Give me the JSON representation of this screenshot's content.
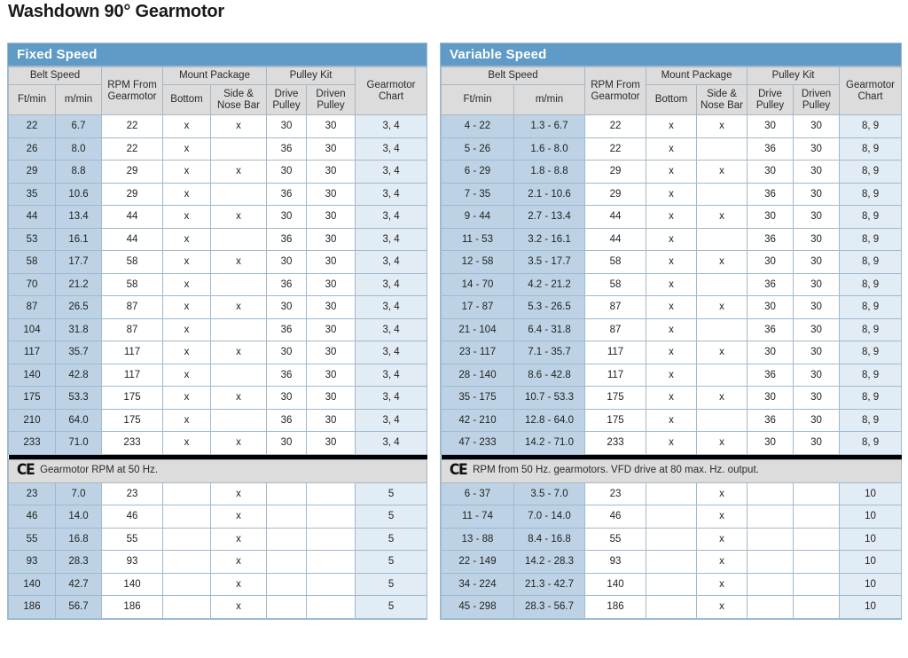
{
  "page": {
    "title": "Washdown 90° Gearmotor"
  },
  "colors": {
    "banner_blue": "#5f9bc6",
    "belt_fill": "#bdd3e5",
    "chart_fill": "#e2ecf5",
    "header_gray": "#dcdcdc",
    "grid_line": "#9fb9cf",
    "divider_black": "#000000"
  },
  "icons": {
    "ce_mark": "CE"
  },
  "headers": {
    "belt_speed": "Belt Speed",
    "ft_min": "Ft/min",
    "m_min": "m/min",
    "rpm_from_gearmotor": "RPM From Gearmotor",
    "mount_package": "Mount Package",
    "bottom": "Bottom",
    "side_nose_bar": "Side & Nose Bar",
    "pulley_kit": "Pulley Kit",
    "drive_pulley": "Drive Pulley",
    "driven_pulley": "Driven Pulley",
    "gearmotor_chart": "Gearmotor Chart"
  },
  "fixed_speed": {
    "banner": "Fixed Speed",
    "note": "Gearmotor RPM at 50 Hz.",
    "rows_main": [
      {
        "ft": "22",
        "m": "6.7",
        "rpm": "22",
        "bottom": "x",
        "side": "x",
        "drive": "30",
        "driven": "30",
        "chart": "3, 4"
      },
      {
        "ft": "26",
        "m": "8.0",
        "rpm": "22",
        "bottom": "x",
        "side": "",
        "drive": "36",
        "driven": "30",
        "chart": "3, 4"
      },
      {
        "ft": "29",
        "m": "8.8",
        "rpm": "29",
        "bottom": "x",
        "side": "x",
        "drive": "30",
        "driven": "30",
        "chart": "3, 4"
      },
      {
        "ft": "35",
        "m": "10.6",
        "rpm": "29",
        "bottom": "x",
        "side": "",
        "drive": "36",
        "driven": "30",
        "chart": "3, 4"
      },
      {
        "ft": "44",
        "m": "13.4",
        "rpm": "44",
        "bottom": "x",
        "side": "x",
        "drive": "30",
        "driven": "30",
        "chart": "3, 4"
      },
      {
        "ft": "53",
        "m": "16.1",
        "rpm": "44",
        "bottom": "x",
        "side": "",
        "drive": "36",
        "driven": "30",
        "chart": "3, 4"
      },
      {
        "ft": "58",
        "m": "17.7",
        "rpm": "58",
        "bottom": "x",
        "side": "x",
        "drive": "30",
        "driven": "30",
        "chart": "3, 4"
      },
      {
        "ft": "70",
        "m": "21.2",
        "rpm": "58",
        "bottom": "x",
        "side": "",
        "drive": "36",
        "driven": "30",
        "chart": "3, 4"
      },
      {
        "ft": "87",
        "m": "26.5",
        "rpm": "87",
        "bottom": "x",
        "side": "x",
        "drive": "30",
        "driven": "30",
        "chart": "3, 4"
      },
      {
        "ft": "104",
        "m": "31.8",
        "rpm": "87",
        "bottom": "x",
        "side": "",
        "drive": "36",
        "driven": "30",
        "chart": "3, 4"
      },
      {
        "ft": "117",
        "m": "35.7",
        "rpm": "117",
        "bottom": "x",
        "side": "x",
        "drive": "30",
        "driven": "30",
        "chart": "3, 4"
      },
      {
        "ft": "140",
        "m": "42.8",
        "rpm": "117",
        "bottom": "x",
        "side": "",
        "drive": "36",
        "driven": "30",
        "chart": "3, 4"
      },
      {
        "ft": "175",
        "m": "53.3",
        "rpm": "175",
        "bottom": "x",
        "side": "x",
        "drive": "30",
        "driven": "30",
        "chart": "3, 4"
      },
      {
        "ft": "210",
        "m": "64.0",
        "rpm": "175",
        "bottom": "x",
        "side": "",
        "drive": "36",
        "driven": "30",
        "chart": "3, 4"
      },
      {
        "ft": "233",
        "m": "71.0",
        "rpm": "233",
        "bottom": "x",
        "side": "x",
        "drive": "30",
        "driven": "30",
        "chart": "3, 4"
      }
    ],
    "rows_ce": [
      {
        "ft": "23",
        "m": "7.0",
        "rpm": "23",
        "bottom": "",
        "side": "x",
        "drive": "",
        "driven": "",
        "chart": "5"
      },
      {
        "ft": "46",
        "m": "14.0",
        "rpm": "46",
        "bottom": "",
        "side": "x",
        "drive": "",
        "driven": "",
        "chart": "5"
      },
      {
        "ft": "55",
        "m": "16.8",
        "rpm": "55",
        "bottom": "",
        "side": "x",
        "drive": "",
        "driven": "",
        "chart": "5"
      },
      {
        "ft": "93",
        "m": "28.3",
        "rpm": "93",
        "bottom": "",
        "side": "x",
        "drive": "",
        "driven": "",
        "chart": "5"
      },
      {
        "ft": "140",
        "m": "42.7",
        "rpm": "140",
        "bottom": "",
        "side": "x",
        "drive": "",
        "driven": "",
        "chart": "5"
      },
      {
        "ft": "186",
        "m": "56.7",
        "rpm": "186",
        "bottom": "",
        "side": "x",
        "drive": "",
        "driven": "",
        "chart": "5"
      }
    ]
  },
  "variable_speed": {
    "banner": "Variable Speed",
    "note": "RPM from 50 Hz. gearmotors. VFD drive at 80 max. Hz. output.",
    "rows_main": [
      {
        "ft": "4 - 22",
        "m": "1.3 - 6.7",
        "rpm": "22",
        "bottom": "x",
        "side": "x",
        "drive": "30",
        "driven": "30",
        "chart": "8, 9"
      },
      {
        "ft": "5 - 26",
        "m": "1.6 - 8.0",
        "rpm": "22",
        "bottom": "x",
        "side": "",
        "drive": "36",
        "driven": "30",
        "chart": "8, 9"
      },
      {
        "ft": "6 - 29",
        "m": "1.8 - 8.8",
        "rpm": "29",
        "bottom": "x",
        "side": "x",
        "drive": "30",
        "driven": "30",
        "chart": "8, 9"
      },
      {
        "ft": "7 - 35",
        "m": "2.1 - 10.6",
        "rpm": "29",
        "bottom": "x",
        "side": "",
        "drive": "36",
        "driven": "30",
        "chart": "8, 9"
      },
      {
        "ft": "9 - 44",
        "m": "2.7 - 13.4",
        "rpm": "44",
        "bottom": "x",
        "side": "x",
        "drive": "30",
        "driven": "30",
        "chart": "8, 9"
      },
      {
        "ft": "11 - 53",
        "m": "3.2 - 16.1",
        "rpm": "44",
        "bottom": "x",
        "side": "",
        "drive": "36",
        "driven": "30",
        "chart": "8, 9"
      },
      {
        "ft": "12 - 58",
        "m": "3.5 - 17.7",
        "rpm": "58",
        "bottom": "x",
        "side": "x",
        "drive": "30",
        "driven": "30",
        "chart": "8, 9"
      },
      {
        "ft": "14 - 70",
        "m": "4.2 - 21.2",
        "rpm": "58",
        "bottom": "x",
        "side": "",
        "drive": "36",
        "driven": "30",
        "chart": "8, 9"
      },
      {
        "ft": "17 - 87",
        "m": "5.3 - 26.5",
        "rpm": "87",
        "bottom": "x",
        "side": "x",
        "drive": "30",
        "driven": "30",
        "chart": "8, 9"
      },
      {
        "ft": "21 - 104",
        "m": "6.4 - 31.8",
        "rpm": "87",
        "bottom": "x",
        "side": "",
        "drive": "36",
        "driven": "30",
        "chart": "8, 9"
      },
      {
        "ft": "23 - 117",
        "m": "7.1 - 35.7",
        "rpm": "117",
        "bottom": "x",
        "side": "x",
        "drive": "30",
        "driven": "30",
        "chart": "8, 9"
      },
      {
        "ft": "28 - 140",
        "m": "8.6 - 42.8",
        "rpm": "117",
        "bottom": "x",
        "side": "",
        "drive": "36",
        "driven": "30",
        "chart": "8, 9"
      },
      {
        "ft": "35 - 175",
        "m": "10.7 - 53.3",
        "rpm": "175",
        "bottom": "x",
        "side": "x",
        "drive": "30",
        "driven": "30",
        "chart": "8, 9"
      },
      {
        "ft": "42 - 210",
        "m": "12.8 - 64.0",
        "rpm": "175",
        "bottom": "x",
        "side": "",
        "drive": "36",
        "driven": "30",
        "chart": "8, 9"
      },
      {
        "ft": "47 - 233",
        "m": "14.2 - 71.0",
        "rpm": "233",
        "bottom": "x",
        "side": "x",
        "drive": "30",
        "driven": "30",
        "chart": "8, 9"
      }
    ],
    "rows_ce": [
      {
        "ft": "6 - 37",
        "m": "3.5 - 7.0",
        "rpm": "23",
        "bottom": "",
        "side": "x",
        "drive": "",
        "driven": "",
        "chart": "10"
      },
      {
        "ft": "11 - 74",
        "m": "7.0 - 14.0",
        "rpm": "46",
        "bottom": "",
        "side": "x",
        "drive": "",
        "driven": "",
        "chart": "10"
      },
      {
        "ft": "13 - 88",
        "m": "8.4 - 16.8",
        "rpm": "55",
        "bottom": "",
        "side": "x",
        "drive": "",
        "driven": "",
        "chart": "10"
      },
      {
        "ft": "22 - 149",
        "m": "14.2 - 28.3",
        "rpm": "93",
        "bottom": "",
        "side": "x",
        "drive": "",
        "driven": "",
        "chart": "10"
      },
      {
        "ft": "34 - 224",
        "m": "21.3 - 42.7",
        "rpm": "140",
        "bottom": "",
        "side": "x",
        "drive": "",
        "driven": "",
        "chart": "10"
      },
      {
        "ft": "45 - 298",
        "m": "28.3 - 56.7",
        "rpm": "186",
        "bottom": "",
        "side": "x",
        "drive": "",
        "driven": "",
        "chart": "10"
      }
    ]
  }
}
